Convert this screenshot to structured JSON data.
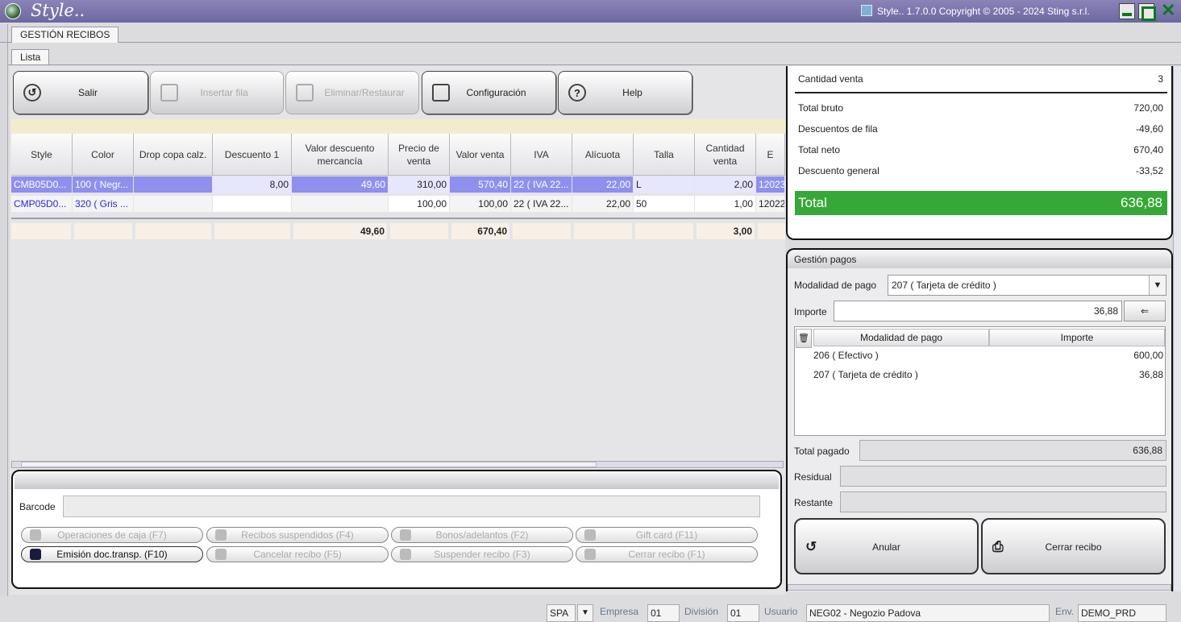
{
  "app": {
    "name": "Style..",
    "copyright": "Style.. 1.7.0.0 Copyright © 2005 - 2024 Sting s.r.l."
  },
  "tabs": {
    "module": "GESTIÓN RECIBOS",
    "sub": "Lista"
  },
  "toolbar": {
    "salir": "Salir",
    "insertar": "Insertar fila",
    "eliminar": "Eliminar/Restaurar",
    "configuracion": "Configuración",
    "help": "Help"
  },
  "grid": {
    "columns": [
      "Style",
      "Color",
      "Drop copa calz.",
      "Descuento 1",
      "Valor descuento mercancía",
      "Precio de venta",
      "Valor venta",
      "IVA",
      "Alícuota",
      "Talla",
      "Cantidad venta",
      "E"
    ],
    "rows": [
      [
        "CMB05D0...",
        "100 ( Negr...",
        "",
        "8,00",
        "49,60",
        "310,00",
        "570,40",
        "22 ( IVA 22...",
        "22,00",
        "L",
        "2,00",
        "12023"
      ],
      [
        "CMP05D0...",
        "320 ( Gris ...",
        "",
        "",
        "",
        "100,00",
        "100,00",
        "22 ( IVA 22...",
        "22,00",
        "50",
        "1,00",
        "12022"
      ]
    ],
    "totals": {
      "valor_descuento": "49,60",
      "valor_venta": "670,40",
      "cantidad": "3,00"
    }
  },
  "bottom": {
    "barcode_label": "Barcode",
    "actions": [
      "Operaciones de caja (F7)",
      "Recibos suspendidos (F4)",
      "Bonos/adelantos (F2)",
      "Gift card (F11)",
      "Emisión doc.transp. (F10)",
      "Cancelar recibo (F5)",
      "Suspender recibo (F3)",
      "Cerrar recibo (F1)"
    ]
  },
  "summary": {
    "cantidad_label": "Cantidad venta",
    "cantidad": "3",
    "bruto_label": "Total bruto",
    "bruto": "720,00",
    "desc_fila_label": "Descuentos de fila",
    "desc_fila": "-49,60",
    "neto_label": "Total neto",
    "neto": "670,40",
    "desc_general_label": "Descuento general",
    "desc_general": "-33,52",
    "total_label": "Total",
    "total": "636,88",
    "total_color": "#36a838"
  },
  "payments": {
    "title": "Gestión pagos",
    "modalidad_label": "Modalidad de pago",
    "modalidad_value": "207 ( Tarjeta de crédito )",
    "importe_label": "Importe",
    "importe_value": "36,88",
    "list_headers": [
      "Modalidad de pago",
      "Importe"
    ],
    "list": [
      {
        "mode": "206 ( Efectivo )",
        "amount": "600,00"
      },
      {
        "mode": "207 ( Tarjeta de crédito )",
        "amount": "36,88"
      }
    ],
    "total_pagado_label": "Total pagado",
    "total_pagado": "636,88",
    "residual_label": "Residual",
    "residual": "",
    "restante_label": "Restante",
    "restante": "",
    "anular": "Anular",
    "cerrar": "Cerrar recibo"
  },
  "status": {
    "lang": "SPA",
    "empresa_label": "Empresa",
    "empresa": "01",
    "division_label": "División",
    "division": "01",
    "usuario_label": "Usuario",
    "usuario": "NEG02 - Negozio Padova",
    "env_label": "Env.",
    "env": "DEMO_PRD"
  }
}
